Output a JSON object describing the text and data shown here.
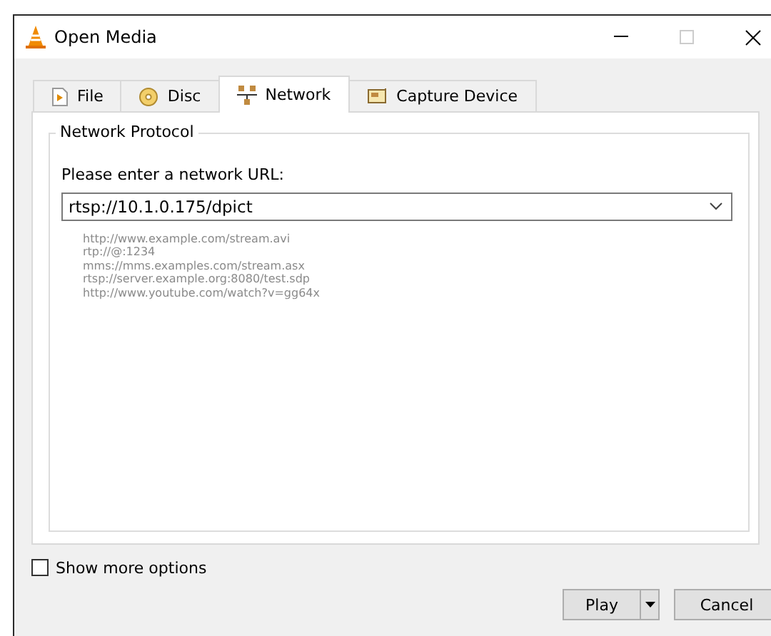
{
  "window": {
    "title": "Open Media"
  },
  "tabs": [
    {
      "label": "File",
      "selected": false
    },
    {
      "label": "Disc",
      "selected": false
    },
    {
      "label": "Network",
      "selected": true
    },
    {
      "label": "Capture Device",
      "selected": false
    }
  ],
  "network_protocol": {
    "title": "Network Protocol",
    "url_label": "Please enter a network URL:",
    "url_value": "rtsp://10.1.0.175/dpict",
    "examples": [
      "http://www.example.com/stream.avi",
      "rtp://@:1234",
      "mms://mms.examples.com/stream.asx",
      "rtsp://server.example.org:8080/test.sdp",
      "http://www.youtube.com/watch?v=gg64x"
    ]
  },
  "show_more_options": {
    "label": "Show more options",
    "checked": false
  },
  "buttons": [
    {
      "label": "Play",
      "kind": "split"
    },
    {
      "label": "Cancel",
      "kind": "plain"
    }
  ]
}
